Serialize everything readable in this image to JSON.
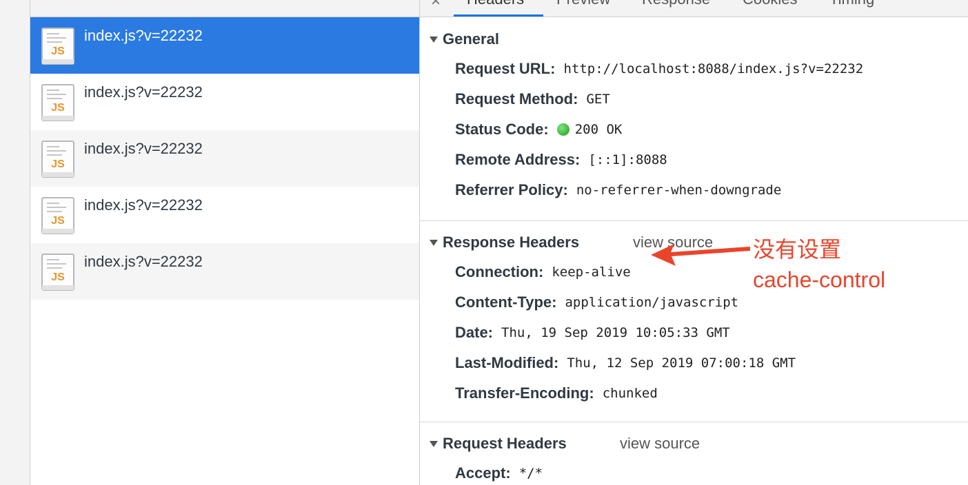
{
  "files": [
    {
      "name": "index.js?v=22232",
      "icon": "JS"
    },
    {
      "name": "index.js?v=22232",
      "icon": "JS"
    },
    {
      "name": "index.js?v=22232",
      "icon": "JS"
    },
    {
      "name": "index.js?v=22232",
      "icon": "JS"
    },
    {
      "name": "index.js?v=22232",
      "icon": "JS"
    }
  ],
  "tabs": [
    "Headers",
    "Preview",
    "Response",
    "Cookies",
    "Timing"
  ],
  "general": {
    "title": "General",
    "rows": [
      {
        "key": "Request URL:",
        "value": "http://localhost:8088/index.js?v=22232"
      },
      {
        "key": "Request Method:",
        "value": "GET"
      },
      {
        "key": "Status Code:",
        "value": "200 OK"
      },
      {
        "key": "Remote Address:",
        "value": "[::1]:8088"
      },
      {
        "key": "Referrer Policy:",
        "value": "no-referrer-when-downgrade"
      }
    ]
  },
  "response_headers": {
    "title": "Response Headers",
    "view_source": "view source",
    "rows": [
      {
        "key": "Connection:",
        "value": "keep-alive"
      },
      {
        "key": "Content-Type:",
        "value": "application/javascript"
      },
      {
        "key": "Date:",
        "value": "Thu, 19 Sep 2019 10:05:33 GMT"
      },
      {
        "key": "Last-Modified:",
        "value": "Thu, 12 Sep 2019 07:00:18 GMT"
      },
      {
        "key": "Transfer-Encoding:",
        "value": "chunked"
      }
    ]
  },
  "request_headers": {
    "title": "Request Headers",
    "view_source": "view source",
    "rows": [
      {
        "key": "Accept:",
        "value": "*/*"
      }
    ]
  },
  "annotation": {
    "line1": "没有设置",
    "line2": "cache-control",
    "color": "#e8452c"
  },
  "colors": {
    "selected_row": "#2a7ae2",
    "status_ok": "#2fb52f",
    "tab_active": "#1a73e8",
    "js_icon": "#e8952a"
  }
}
